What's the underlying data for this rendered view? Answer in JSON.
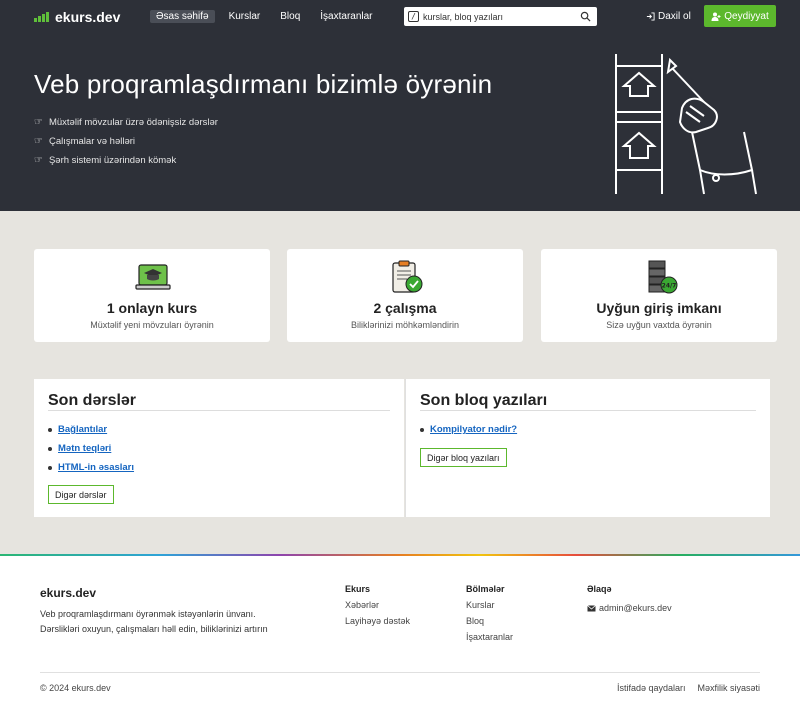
{
  "nav": {
    "logo": "ekurs.dev",
    "links": [
      "Əsas səhifə",
      "Kurslar",
      "Bloq",
      "İşaxtaranlar"
    ],
    "search_placeholder": "kurslar, bloq yazıları",
    "login": "Daxil ol",
    "register": "Qeydiyyat"
  },
  "hero": {
    "title": "Veb proqramlaşdırmanı bizimlə öyrənin",
    "bullets": [
      "Müxtəlif mövzular üzrə ödənişsiz dərslər",
      "Çalışmalar və həlləri",
      "Şərh sistemi üzərindən kömək"
    ]
  },
  "features": [
    {
      "title": "1 onlayn kurs",
      "subtitle": "Müxtəlif yeni mövzuları öyrənin",
      "icon": "graduation-laptop-icon"
    },
    {
      "title": "2 çalışma",
      "subtitle": "Biliklərinizi möhkəmləndirin",
      "icon": "clipboard-check-icon"
    },
    {
      "title": "Uyğun giriş imkanı",
      "subtitle": "Sizə uyğun vaxtda öyrənin",
      "icon": "server-24-7-icon"
    }
  ],
  "lessons": {
    "title": "Son dərslər",
    "items": [
      "Bağlantılar",
      "Mətn teqləri",
      "HTML-in əsasları"
    ],
    "button": "Digər dərslər"
  },
  "blog": {
    "title": "Son bloq yazıları",
    "items": [
      "Kompilyator nədir?"
    ],
    "button": "Digər bloq yazıları"
  },
  "footer": {
    "brand": "ekurs.dev",
    "description": "Veb proqramlaşdırmanı öyrənmək istəyənlərin ünvanı. Dərslikləri oxuyun, çalışmaları həll edin, biliklərinizi artırın",
    "col1": {
      "title": "Ekurs",
      "items": [
        "Xəbərlər",
        "Layihəyə dəstək"
      ]
    },
    "col2": {
      "title": "Bölmələr",
      "items": [
        "Kurslar",
        "Bloq",
        "İşaxtaranlar"
      ]
    },
    "col3": {
      "title": "Əlaqə",
      "email": "admin@ekurs.dev"
    },
    "copyright": "© 2024 ekurs.dev",
    "terms": "İstifadə qaydaları",
    "privacy": "Məxfilik siyasəti"
  },
  "colors": {
    "header_bg": "#2d3038",
    "accent_green": "#5cb82d",
    "link_blue": "#1565c0",
    "page_bg": "#e6e4df"
  }
}
